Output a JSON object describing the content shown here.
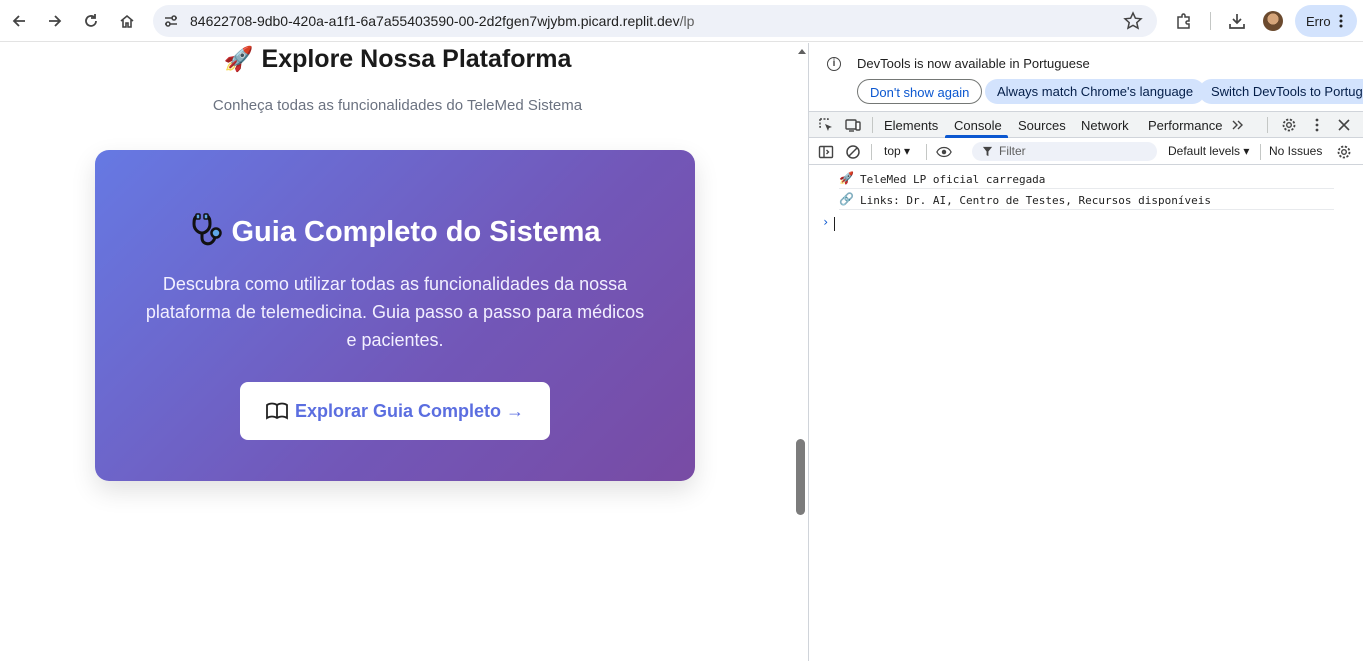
{
  "browser": {
    "url_host": "84622708-9db0-420a-a1f1-6a7a55403590-00-2d2fgen7wjybm.picard.replit.dev",
    "url_path": "/lp",
    "profile_label": "Erro"
  },
  "page": {
    "explore_title": "Explore Nossa Plataforma",
    "explore_emoji": "🚀",
    "explore_subtitle": "Conheça todas as funcionalidades do TeleMed Sistema",
    "card": {
      "title": "Guia Completo do Sistema",
      "description": "Descubra como utilizar todas as funcionalidades da nossa plataforma de telemedicina. Guia passo a passo para médicos e pacientes.",
      "button_label": "Explorar Guia Completo →",
      "gradient_start": "#667eea",
      "gradient_end": "#764ba2"
    }
  },
  "devtools": {
    "notice": {
      "text": "DevTools is now available in Portuguese",
      "dont_show": "Don't show again",
      "always_match": "Always match Chrome's language",
      "switch": "Switch DevTools to Portuguese"
    },
    "tabs": [
      "Elements",
      "Console",
      "Sources",
      "Network",
      "Performance"
    ],
    "active_tab": "Console",
    "context": "top",
    "filter_placeholder": "Filter",
    "levels": "Default levels",
    "issues": "No Issues",
    "logs": [
      {
        "emoji": "🚀",
        "text": "TeleMed LP oficial carregada"
      },
      {
        "emoji": "🔗",
        "text": "Links: Dr. AI, Centro de Testes, Recursos disponíveis"
      }
    ],
    "accent": "#0b57d0"
  }
}
